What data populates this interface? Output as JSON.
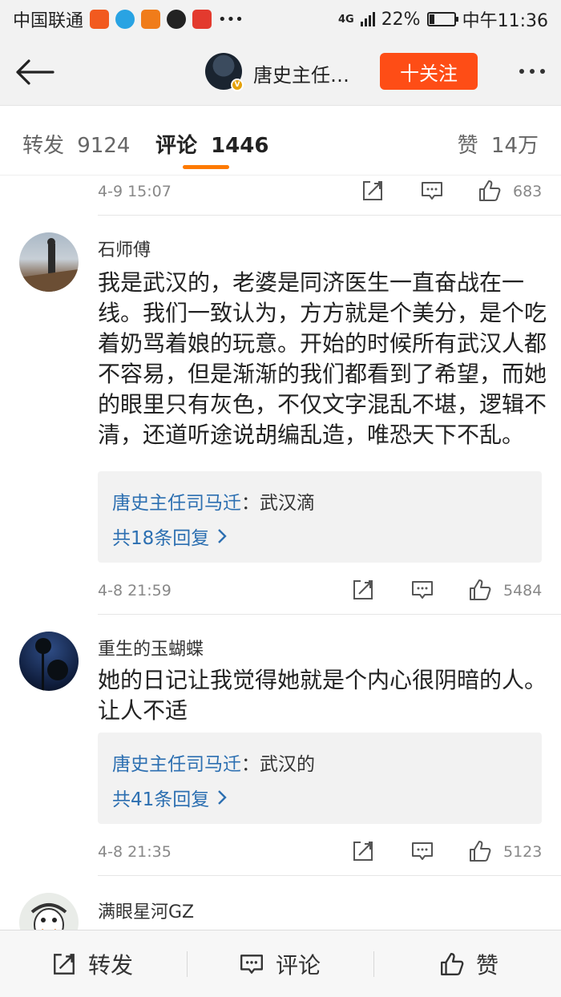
{
  "status_bar": {
    "carrier": "中国联通",
    "network": "4G",
    "battery": "22%",
    "battery_level": 0.22,
    "time": "中午11:36"
  },
  "header": {
    "account_name": "唐史主任…",
    "follow_label": "十关注"
  },
  "tabs": [
    {
      "label": "转发",
      "count": "9124"
    },
    {
      "label": "评论",
      "count": "1446"
    },
    {
      "label": "赞",
      "count": "14万"
    }
  ],
  "top_meta": {
    "time": "4-9 15:07",
    "likes": "683"
  },
  "comments": [
    {
      "user": "石师傅",
      "text": "我是武汉的，老婆是同济医生一直奋战在一线。我们一致认为，方方就是个美分，是个吃着奶骂着娘的玩意。开始的时候所有武汉人都不容易，但是渐渐的我们都看到了希望，而她的眼里只有灰色，不仅文字混乱不堪，逻辑不清，还道听途说胡编乱造，唯恐天下不乱。",
      "reply_author": "唐史主任司马迁",
      "reply_text": "武汉滴",
      "reply_count": "共18条回复",
      "time": "4-8 21:59",
      "likes": "5484"
    },
    {
      "user": "重生的玉蝴蝶",
      "text": "她的日记让我觉得她就是个内心很阴暗的人。让人不适",
      "reply_author": "唐史主任司马迁",
      "reply_text": "武汉的",
      "reply_count": "共41条回复",
      "time": "4-8 21:35",
      "likes": "5123"
    },
    {
      "user": "满眼星河GZ"
    }
  ],
  "bottom_bar": {
    "repost": "转发",
    "comment": "评论",
    "like": "赞"
  },
  "colors": {
    "accent_orange": "#fe4d16",
    "tab_underline": "#fe7a00",
    "link_blue": "#2c6fb1"
  }
}
